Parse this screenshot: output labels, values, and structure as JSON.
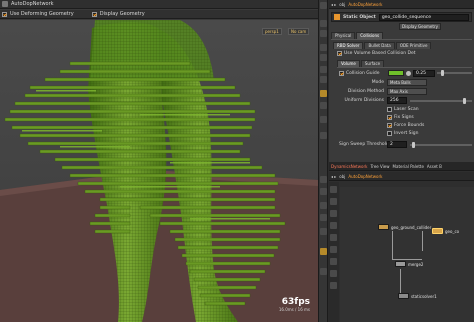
{
  "viewport": {
    "tab_title": "AutoDopNetwork",
    "use_deforming_label": "Use Deforming Geometry",
    "display_geometry_label": "Display Geometry",
    "camera_badge_1": "persp1",
    "camera_badge_2": "No cam",
    "fps_value": "63fps",
    "fps_sub": "16.0ms / 16 ms"
  },
  "parameters": {
    "path_label": "obj",
    "path_node": "AutoDopNetwork",
    "node_type": "Static Object",
    "node_name": "geo_collide_sequence",
    "display_geometry_tab": "Display Geometry",
    "tabs": [
      "Physical",
      "Collisions"
    ],
    "subtabs": [
      "RBD Solver",
      "Bullet Data",
      "ODE Primitive"
    ],
    "use_volume_based": "Use Volume Based Collision Det",
    "vol_tabs": [
      "Volume",
      "Surface"
    ],
    "collision_guide_label": "Collision Guide",
    "collision_guide_value": "0.25",
    "mode_label": "Mode",
    "mode_value": "Meta Balls",
    "division_method_label": "Division Method",
    "division_method_value": "Max Axis",
    "uniform_divisions_label": "Uniform Divisions",
    "uniform_divisions_value": "256",
    "laser_scan_label": "Laser Scan",
    "fix_signs_label": "Fix Signs",
    "force_bounds_label": "Force Bounds",
    "invert_sign_label": "Invert Sign",
    "sign_sweep_label": "Sign Sweep Threshold",
    "sign_sweep_value": "2"
  },
  "network": {
    "tabs": [
      "DynamicsNetwork",
      "Tree View",
      "Material Palette",
      "Asset B"
    ],
    "path_label": "obj",
    "path_node": "AutoDopNetwork",
    "nodes": [
      "geo_ground_collider",
      "geo_co",
      "merge2",
      "staticsolver1"
    ]
  },
  "colors": {
    "accent_orange": "#ff9c1c",
    "guide_green": "#6fbf2a",
    "model_green": "#5e8a1e"
  }
}
